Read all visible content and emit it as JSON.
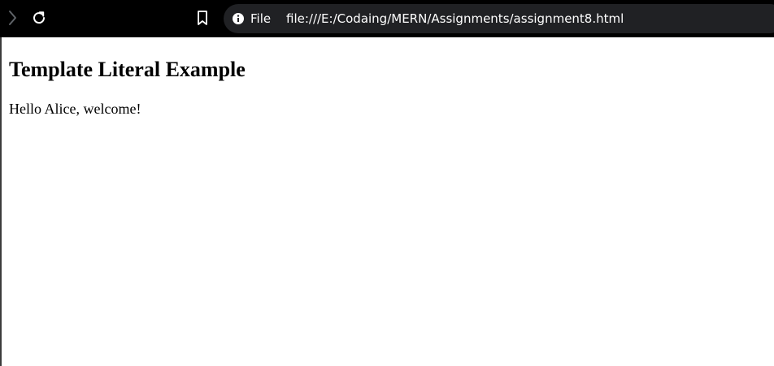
{
  "browser": {
    "site_info_label": "File",
    "address": "file:///E:/Codaing/MERN/Assignments/assignment8.html",
    "icons": {
      "forward": "chevron-right-icon",
      "reload": "reload-icon",
      "bookmark": "bookmark-icon",
      "site_info": "info-icon"
    }
  },
  "page": {
    "heading": "Template Literal Example",
    "paragraph": "Hello Alice, welcome!"
  }
}
